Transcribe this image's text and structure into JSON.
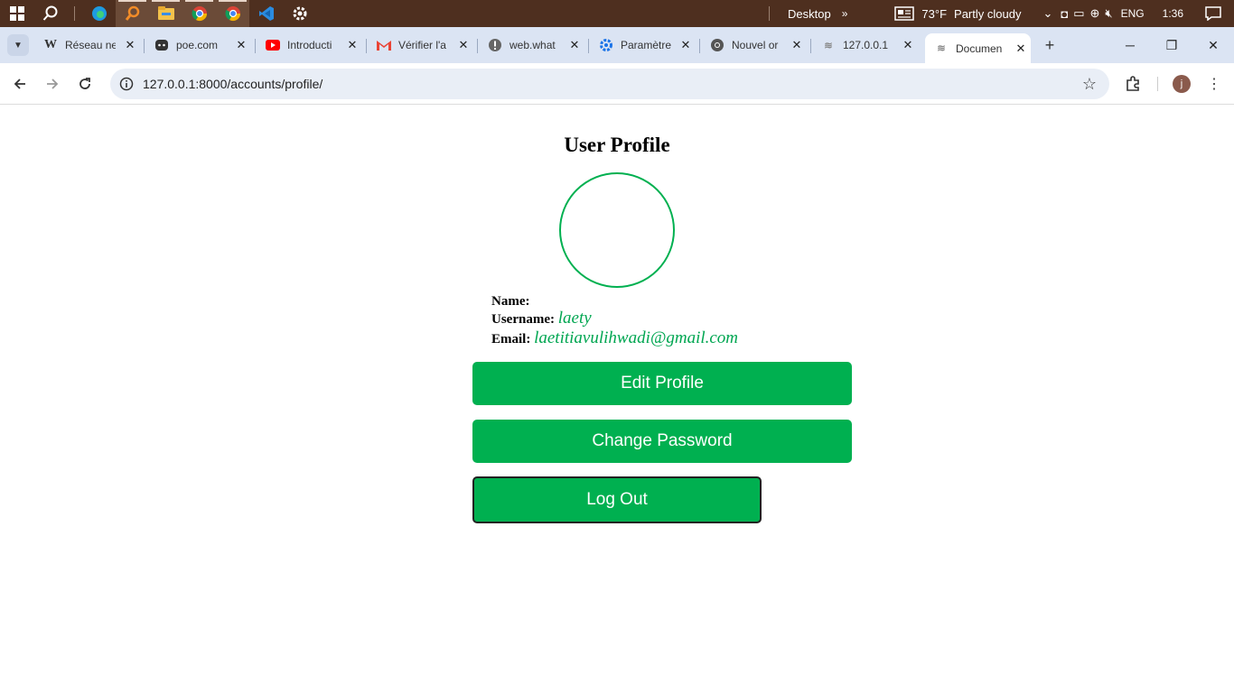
{
  "taskbar": {
    "desktop_label": "Desktop",
    "temperature": "73°F",
    "weather": "Partly cloudy",
    "language": "ENG",
    "time": "1:36"
  },
  "tabs": [
    {
      "title": "Réseau ne",
      "icon": "wikipedia-icon"
    },
    {
      "title": "poe.com",
      "icon": "poe-icon"
    },
    {
      "title": "Introducti",
      "icon": "youtube-icon"
    },
    {
      "title": "Vérifier l'a",
      "icon": "gmail-icon"
    },
    {
      "title": "web.what",
      "icon": "alert-icon"
    },
    {
      "title": "Paramètre",
      "icon": "settings-icon"
    },
    {
      "title": "Nouvel or",
      "icon": "chrome-icon"
    },
    {
      "title": "127.0.0.1",
      "icon": "page-icon"
    },
    {
      "title": "Documen",
      "icon": "page-icon"
    }
  ],
  "address_bar": {
    "url": "127.0.0.1:8000/accounts/profile/"
  },
  "profile_avatar_letter": "j",
  "page": {
    "title": "User Profile",
    "name_label": "Name:",
    "name_value": "",
    "username_label": "Username:",
    "username_value": "laety",
    "email_label": "Email:",
    "email_value": "laetitiavulihwadi@gmail.com",
    "edit_button": "Edit Profile",
    "change_password_button": "Change Password",
    "logout_button": "Log Out"
  },
  "colors": {
    "accent_green": "#00b050",
    "taskbar": "#4e2f1f",
    "tabstrip": "#dbe4f3"
  }
}
